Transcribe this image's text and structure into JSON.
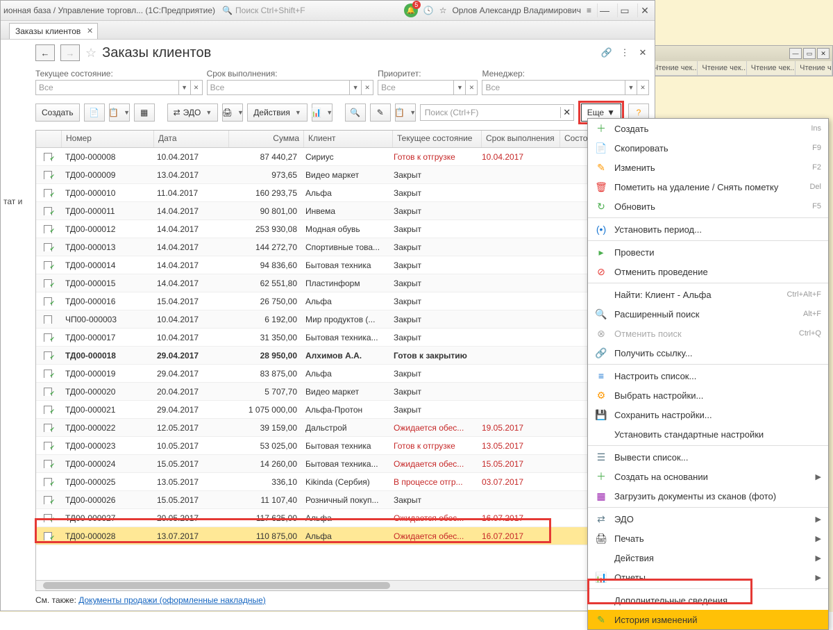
{
  "titlebar": {
    "title": "ионная база / Управление торговл...   (1С:Предприятие)",
    "search_placeholder": "Поиск Ctrl+Shift+F",
    "user": "Орлов Александр Владимирович",
    "badge_count": "5"
  },
  "tab": {
    "label": "Заказы клиентов"
  },
  "page": {
    "title": "Заказы клиентов",
    "see_also_label": "См. также:",
    "see_also_link": "Документы продажи (оформленные накладные)"
  },
  "filters": {
    "state": {
      "label": "Текущее состояние:",
      "value": "Все"
    },
    "due": {
      "label": "Срок выполнения:",
      "value": "Все"
    },
    "priority": {
      "label": "Приоритет:",
      "value": "Все"
    },
    "manager": {
      "label": "Менеджер:",
      "value": "Все"
    }
  },
  "toolbar": {
    "create": "Создать",
    "edo": "ЭДО",
    "actions": "Действия",
    "search_placeholder": "Поиск (Ctrl+F)",
    "more": "Еще"
  },
  "columns": {
    "number": "Номер",
    "date": "Дата",
    "sum": "Сумма",
    "client": "Клиент",
    "state": "Текущее состояние",
    "due": "Срок выполнения",
    "order_state": "Состояние Э"
  },
  "rows": [
    {
      "num": "ТД00-000008",
      "date": "10.04.2017",
      "sum": "87 440,27",
      "client": "Сириус",
      "state": "Готов к отгрузке",
      "due": "10.04.2017",
      "red": true,
      "bold": false
    },
    {
      "num": "ТД00-000009",
      "date": "13.04.2017",
      "sum": "973,65",
      "client": "Видео маркет",
      "state": "Закрыт",
      "due": "",
      "red": false,
      "bold": false
    },
    {
      "num": "ТД00-000010",
      "date": "11.04.2017",
      "sum": "160 293,75",
      "client": "Альфа",
      "state": "Закрыт",
      "due": "",
      "red": false,
      "bold": false
    },
    {
      "num": "ТД00-000011",
      "date": "14.04.2017",
      "sum": "90 801,00",
      "client": "Инвема",
      "state": "Закрыт",
      "due": "",
      "red": false,
      "bold": false
    },
    {
      "num": "ТД00-000012",
      "date": "14.04.2017",
      "sum": "253 930,08",
      "client": "Модная обувь",
      "state": "Закрыт",
      "due": "",
      "red": false,
      "bold": false
    },
    {
      "num": "ТД00-000013",
      "date": "14.04.2017",
      "sum": "144 272,70",
      "client": "Спортивные това...",
      "state": "Закрыт",
      "due": "",
      "red": false,
      "bold": false
    },
    {
      "num": "ТД00-000014",
      "date": "14.04.2017",
      "sum": "94 836,60",
      "client": "Бытовая техника",
      "state": "Закрыт",
      "due": "",
      "red": false,
      "bold": false
    },
    {
      "num": "ТД00-000015",
      "date": "14.04.2017",
      "sum": "62 551,80",
      "client": "Пластинформ",
      "state": "Закрыт",
      "due": "",
      "red": false,
      "bold": false
    },
    {
      "num": "ТД00-000016",
      "date": "15.04.2017",
      "sum": "26 750,00",
      "client": "Альфа",
      "state": "Закрыт",
      "due": "",
      "red": false,
      "bold": false
    },
    {
      "num": "ЧП00-000003",
      "date": "10.04.2017",
      "sum": "6 192,00",
      "client": "Мир продуктов (...",
      "state": "Закрыт",
      "due": "",
      "red": false,
      "bold": false,
      "icon": "plain"
    },
    {
      "num": "ТД00-000017",
      "date": "10.04.2017",
      "sum": "31 350,00",
      "client": "Бытовая техника...",
      "state": "Закрыт",
      "due": "",
      "red": false,
      "bold": false
    },
    {
      "num": "ТД00-000018",
      "date": "29.04.2017",
      "sum": "28 950,00",
      "client": "Алхимов А.А.",
      "state": "Готов к закрытию",
      "due": "",
      "red": false,
      "bold": true
    },
    {
      "num": "ТД00-000019",
      "date": "29.04.2017",
      "sum": "83 875,00",
      "client": "Альфа",
      "state": "Закрыт",
      "due": "",
      "red": false,
      "bold": false
    },
    {
      "num": "ТД00-000020",
      "date": "20.04.2017",
      "sum": "5 707,70",
      "client": "Видео маркет",
      "state": "Закрыт",
      "due": "",
      "red": false,
      "bold": false
    },
    {
      "num": "ТД00-000021",
      "date": "29.04.2017",
      "sum": "1 075 000,00",
      "client": "Альфа-Протон",
      "state": "Закрыт",
      "due": "",
      "red": false,
      "bold": false
    },
    {
      "num": "ТД00-000022",
      "date": "12.05.2017",
      "sum": "39 159,00",
      "client": "Дальстрой",
      "state": "Ожидается обес...",
      "due": "19.05.2017",
      "red": true,
      "bold": false
    },
    {
      "num": "ТД00-000023",
      "date": "10.05.2017",
      "sum": "53 025,00",
      "client": "Бытовая техника",
      "state": "Готов к отгрузке",
      "due": "13.05.2017",
      "red": true,
      "bold": false
    },
    {
      "num": "ТД00-000024",
      "date": "15.05.2017",
      "sum": "14 260,00",
      "client": "Бытовая техника...",
      "state": "Ожидается обес...",
      "due": "15.05.2017",
      "red": true,
      "bold": false
    },
    {
      "num": "ТД00-000025",
      "date": "13.05.2017",
      "sum": "336,10",
      "client": "Kikinda (Сербия)",
      "state": "В процессе отгр...",
      "due": "03.07.2017",
      "red": true,
      "bold": false
    },
    {
      "num": "ТД00-000026",
      "date": "15.05.2017",
      "sum": "11 107,40",
      "client": "Розничный покуп...",
      "state": "Закрыт",
      "due": "",
      "red": false,
      "bold": false
    },
    {
      "num": "ТД00-000027",
      "date": "20.05.2017",
      "sum": "117 625,00",
      "client": "Альфа",
      "state": "Ожидается обес...",
      "due": "16.07.2017",
      "red": true,
      "bold": false
    },
    {
      "num": "ТД00-000028",
      "date": "13.07.2017",
      "sum": "110 875,00",
      "client": "Альфа",
      "state": "Ожидается обес...",
      "due": "16.07.2017",
      "red": true,
      "bold": false,
      "selected": true
    }
  ],
  "menu": [
    {
      "icon": "＋",
      "label": "Создать",
      "short": "Ins",
      "color": "#4caf50"
    },
    {
      "icon": "📄",
      "label": "Скопировать",
      "short": "F9"
    },
    {
      "icon": "✎",
      "label": "Изменить",
      "short": "F2",
      "color": "#ff9800"
    },
    {
      "icon": "🗑",
      "label": "Пометить на удаление / Снять пометку",
      "short": "Del",
      "color": "#e53935"
    },
    {
      "icon": "↻",
      "label": "Обновить",
      "short": "F5",
      "color": "#4caf50"
    },
    {
      "sep": true
    },
    {
      "icon": "(•)",
      "label": "Установить период...",
      "color": "#1976d2"
    },
    {
      "sep": true
    },
    {
      "icon": "▸",
      "label": "Провести",
      "color": "#4caf50"
    },
    {
      "icon": "⊘",
      "label": "Отменить проведение",
      "color": "#e53935"
    },
    {
      "sep": true
    },
    {
      "icon": "",
      "label": "Найти: Клиент - Альфа",
      "short": "Ctrl+Alt+F"
    },
    {
      "icon": "🔍",
      "label": "Расширенный поиск",
      "short": "Alt+F"
    },
    {
      "icon": "⊗",
      "label": "Отменить поиск",
      "short": "Ctrl+Q",
      "disabled": true
    },
    {
      "icon": "🔗",
      "label": "Получить ссылку..."
    },
    {
      "sep": true
    },
    {
      "icon": "≡",
      "label": "Настроить список...",
      "color": "#1976d2"
    },
    {
      "icon": "⚙",
      "label": "Выбрать настройки...",
      "color": "#ff9800"
    },
    {
      "icon": "💾",
      "label": "Сохранить настройки...",
      "color": "#1976d2"
    },
    {
      "icon": "",
      "label": "Установить стандартные настройки"
    },
    {
      "sep": true
    },
    {
      "icon": "☰",
      "label": "Вывести список...",
      "color": "#607d8b"
    },
    {
      "icon": "＋",
      "label": "Создать на основании",
      "arrow": true,
      "color": "#4caf50"
    },
    {
      "icon": "▦",
      "label": "Загрузить документы из сканов (фото)",
      "color": "#9c27b0"
    },
    {
      "sep": true
    },
    {
      "icon": "⇄",
      "label": "ЭДО",
      "arrow": true,
      "color": "#607d8b"
    },
    {
      "icon": "🖨",
      "label": "Печать",
      "arrow": true
    },
    {
      "icon": "",
      "label": "Действия",
      "arrow": true
    },
    {
      "icon": "📊",
      "label": "Отчеты",
      "arrow": true,
      "color": "#4caf50"
    },
    {
      "sep": true
    },
    {
      "icon": "",
      "label": "Дополнительные сведения"
    },
    {
      "icon": "✎",
      "label": "История изменений",
      "highlighted": true,
      "color": "#4caf50"
    }
  ],
  "bg_tabs": [
    "Чтение чек...",
    "Чтение чек...",
    "Чтение чек...",
    "Чтение ч"
  ],
  "left_panel": {
    "text": "тат и"
  }
}
